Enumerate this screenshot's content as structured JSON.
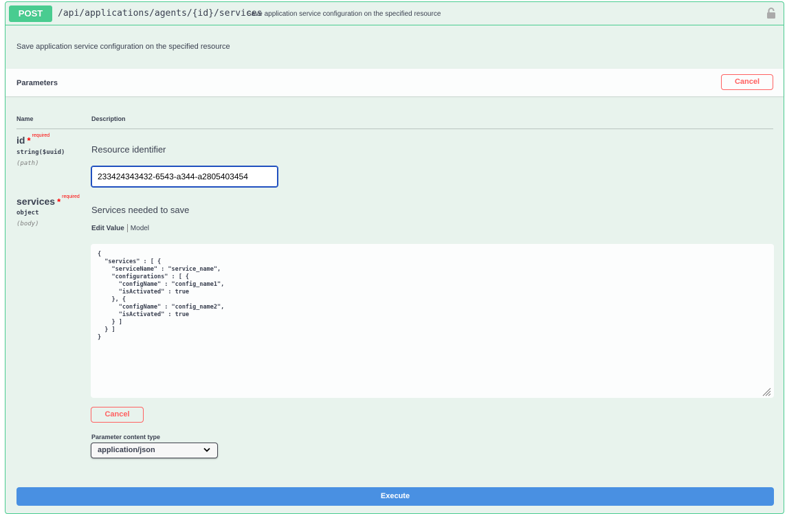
{
  "summary": {
    "method": "POST",
    "path": "/api/applications/agents/{id}/services",
    "description": "Save application service configuration on the specified resource"
  },
  "operation_description": "Save application service configuration on the specified resource",
  "parameters_section": {
    "title": "Parameters",
    "cancel_label": "Cancel"
  },
  "table_headers": {
    "name": "Name",
    "description": "Description"
  },
  "params": [
    {
      "name": "id",
      "star": "*",
      "required_label": "required",
      "type": "string($uuid)",
      "in": "(path)",
      "description": "Resource identifier",
      "value": "233424343432-6543-a344-a2805403454"
    },
    {
      "name": "services",
      "star": "*",
      "required_label": "required",
      "type": "object",
      "in": "(body)",
      "description": "Services needed to save",
      "tabs": [
        "Edit Value",
        "Model"
      ],
      "body": "{\n  \"services\" : [ {\n    \"serviceName\" : \"service_name\",\n    \"configurations\" : [ {\n      \"configName\" : \"config_name1\",\n      \"isActivated\" : true\n    }, {\n      \"configName\" : \"config_name2\",\n      \"isActivated\" : true\n    } ]\n  } ]\n}",
      "cancel_label": "Cancel"
    }
  ],
  "content_type": {
    "label": "Parameter content type",
    "selected": "application/json"
  },
  "execute_label": "Execute",
  "colors": {
    "post": "#49cc90",
    "background": "#e8f3ed",
    "cancel": "#ff6060",
    "execute": "#4990e2"
  },
  "icons": [
    "lock-icon",
    "chevron-down-icon",
    "resize-grip-icon"
  ]
}
